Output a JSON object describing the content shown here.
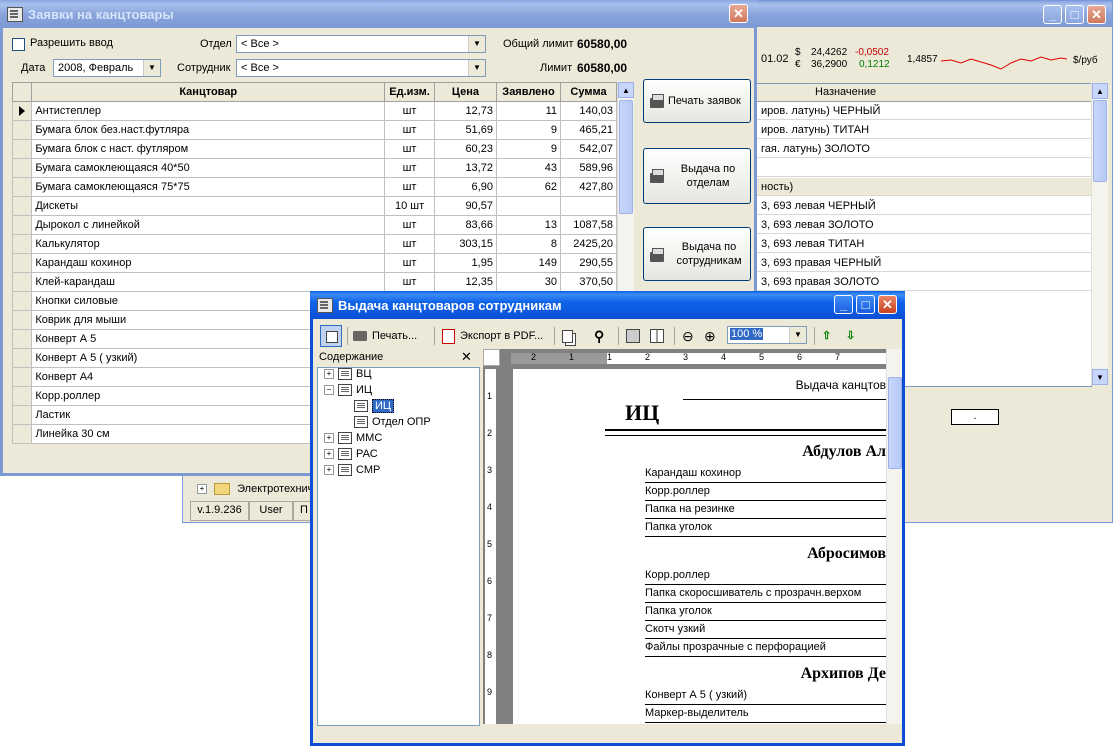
{
  "back": {
    "currency": {
      "date": "01.02",
      "usd_sym": "$",
      "usd_rate": "24,4262",
      "usd_change": "-0,0502",
      "eur_sym": "€",
      "eur_rate": "36,2900",
      "eur_change": "0,1212",
      "cross": "1,4857",
      "unit": "$/руб"
    },
    "assign_header": "Назначение",
    "assign_rows": [
      "иров. латунь) ЧЕРНЫЙ",
      "иров. латунь) ТИТАН",
      "гая. латунь) ЗОЛОТО",
      "",
      "ность)",
      "3, 693 левая  ЧЕРНЫЙ",
      "3, 693 левая ЗОЛОТО",
      "3, 693 левая  ТИТАН",
      "3, 693 правая  ЧЕРНЫЙ",
      "3, 693 правая  ЗОЛОТО"
    ],
    "field_dot": ".",
    "tree_item": "Электротехниче",
    "status": [
      "v.1.9.236",
      "User",
      "П"
    ]
  },
  "orders": {
    "title": "Заявки на канцтовары",
    "allow_input": "Разрешить ввод",
    "dept_label": "Отдел",
    "dept_value": "< Все >",
    "employee_label": "Сотрудник",
    "employee_value": "< Все >",
    "date_label": "Дата",
    "date_value": "2008, Февраль",
    "total_limit_label": "Общий лимит",
    "total_limit_value": "60580,00",
    "limit_label": "Лимит",
    "limit_value": "60580,00",
    "columns": [
      "Канцтовар",
      "Ед.изм.",
      "Цена",
      "Заявлено",
      "Сумма"
    ],
    "rows": [
      [
        "Антистеплер",
        "шт",
        "12,73",
        "11",
        "140,03"
      ],
      [
        "Бумага блок без.наст.футляра",
        "шт",
        "51,69",
        "9",
        "465,21"
      ],
      [
        "Бумага блок с наст. футляром",
        "шт",
        "60,23",
        "9",
        "542,07"
      ],
      [
        "Бумага самоклеющаяся 40*50",
        "шт",
        "13,72",
        "43",
        "589,96"
      ],
      [
        "Бумага самоклеющаяся 75*75",
        "шт",
        "6,90",
        "62",
        "427,80"
      ],
      [
        "Дискеты",
        "10 шт",
        "90,57",
        "",
        ""
      ],
      [
        "Дырокол с линейкой",
        "шт",
        "83,66",
        "13",
        "1087,58"
      ],
      [
        "Калькулятор",
        "шт",
        "303,15",
        "8",
        "2425,20"
      ],
      [
        "Карандаш кохинор",
        "шт",
        "1,95",
        "149",
        "290,55"
      ],
      [
        "Клей-карандаш",
        "шт",
        "12,35",
        "30",
        "370,50"
      ],
      [
        "Кнопки силовые",
        "",
        "",
        "",
        ""
      ],
      [
        "Коврик для мыши",
        "",
        "",
        "",
        ""
      ],
      [
        "Конверт А 5",
        "",
        "",
        "",
        ""
      ],
      [
        "Конверт А 5 ( узкий)",
        "",
        "",
        "",
        ""
      ],
      [
        "Конверт А4",
        "",
        "",
        "",
        ""
      ],
      [
        "Корр.роллер",
        "",
        "",
        "",
        ""
      ],
      [
        "Ластик",
        "",
        "",
        "",
        ""
      ],
      [
        "Линейка 30 см",
        "",
        "",
        "",
        ""
      ]
    ],
    "btn_print": "Печать заявок",
    "btn_by_dept_1": "Выдача по",
    "btn_by_dept_2": "отделам",
    "btn_by_emp_1": "Выдача по",
    "btn_by_emp_2": "сотрудникам"
  },
  "report": {
    "title": "Выдача канцтоваров сотрудникам",
    "toolbar": {
      "print": "Печать...",
      "export": "Экспорт в PDF...",
      "zoom": "100 %"
    },
    "contents_label": "Содержание",
    "tree": [
      {
        "label": "ВЦ",
        "level": 0,
        "exp": "+"
      },
      {
        "label": "ИЦ",
        "level": 0,
        "exp": "−"
      },
      {
        "label": "ИЦ",
        "level": 1,
        "exp": "",
        "selected": true
      },
      {
        "label": "Отдел ОПР",
        "level": 1,
        "exp": ""
      },
      {
        "label": "ММС",
        "level": 0,
        "exp": "+"
      },
      {
        "label": "РАС",
        "level": 0,
        "exp": "+"
      },
      {
        "label": "СМР",
        "level": 0,
        "exp": "+"
      }
    ],
    "ruler_labels": [
      "2",
      "1",
      "1",
      "2",
      "3",
      "4",
      "5",
      "6",
      "7"
    ],
    "vruler_labels": [
      "1",
      "2",
      "3",
      "4",
      "5",
      "6",
      "7",
      "8",
      "9"
    ],
    "doc_header": "Выдача канцтов",
    "section": "ИЦ",
    "people": [
      {
        "name": "Абдулов Ал",
        "items": [
          "Карандаш кохинор",
          "Корр.роллер",
          "Папка на резинке",
          "Папка уголок"
        ]
      },
      {
        "name": "Абросимов",
        "items": [
          "Корр.роллер",
          "Папка скоросшиватель с прозрачн.верхом",
          "Папка уголок",
          "Скотч узкий",
          "Файлы прозрачные с перфорацией"
        ]
      },
      {
        "name": "Архипов Де",
        "items": [
          "Конверт А 5 ( узкий)",
          "Маркер-выделитель",
          ""
        ]
      }
    ]
  }
}
